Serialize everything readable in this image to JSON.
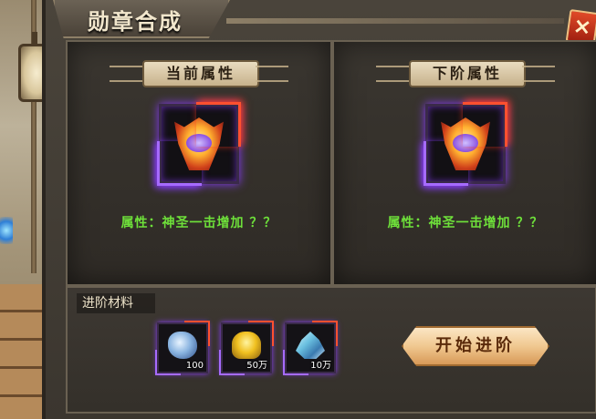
{
  "window": {
    "title": "勋章合成",
    "close_glyph": "×"
  },
  "current": {
    "label": "当前属性",
    "attribute": "属性：神圣一击增加 ？？"
  },
  "next": {
    "label": "下阶属性",
    "attribute": "属性：神圣一击增加 ？？"
  },
  "materials": {
    "title": "进阶材料",
    "items": [
      {
        "icon": "crystal-ore-icon",
        "quantity": "100"
      },
      {
        "icon": "gold-ingot-icon",
        "quantity": "50万"
      },
      {
        "icon": "blue-gem-icon",
        "quantity": "10万"
      }
    ]
  },
  "actions": {
    "start_label": "开始进阶"
  },
  "colors": {
    "attribute_text": "#6ee03a",
    "frame_purple": "#a66bff",
    "frame_red": "#ff5030",
    "button_gold": "#f0c890"
  }
}
